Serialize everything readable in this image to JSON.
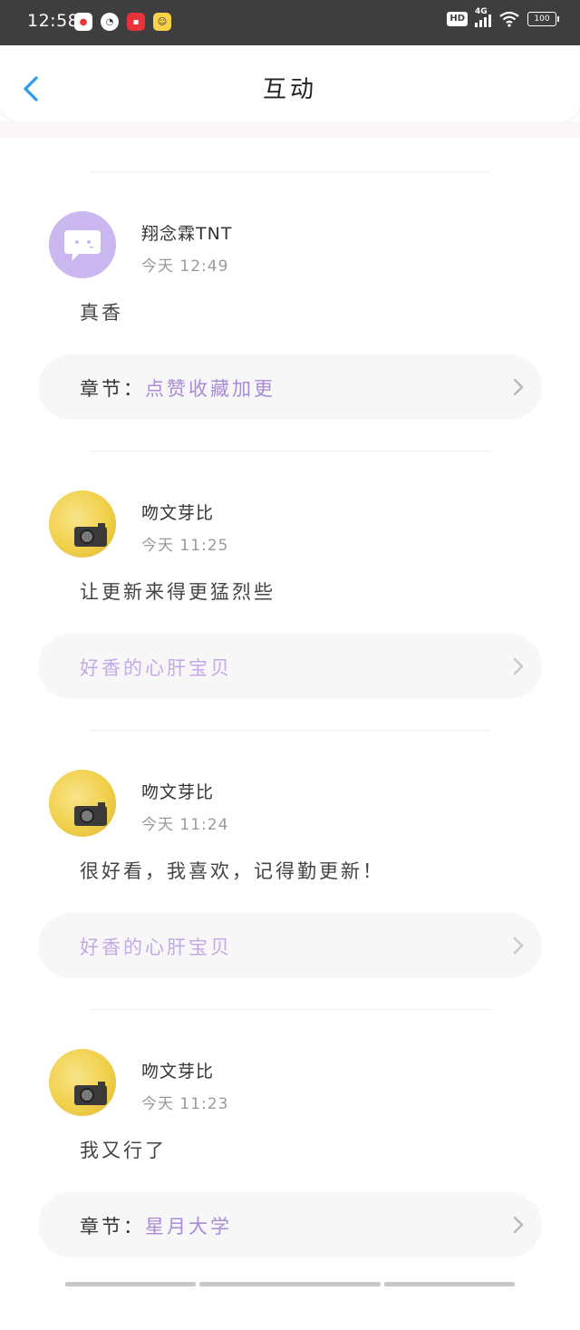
{
  "status_bar": {
    "time": "12:58",
    "network": "4G",
    "hd_label": "HD",
    "battery": "100"
  },
  "header": {
    "title": "互动"
  },
  "entries": [
    {
      "username": "翔念霖TNT",
      "time": "今天 12:49",
      "comment": "真香",
      "chapter_prefix": "章节：",
      "chapter_name": "点赞收藏加更"
    },
    {
      "username": "吻文芽比",
      "time": "今天 11:25",
      "comment": "让更新来得更猛烈些",
      "chapter_prefix": "",
      "chapter_name": "好香的心肝宝贝"
    },
    {
      "username": "吻文芽比",
      "time": "今天 11:24",
      "comment": "很好看，我喜欢，记得勤更新！",
      "chapter_prefix": "",
      "chapter_name": "好香的心肝宝贝"
    },
    {
      "username": "吻文芽比",
      "time": "今天 11:23",
      "comment": "我又行了",
      "chapter_prefix": "章节：",
      "chapter_name": "星月大学"
    }
  ],
  "colors": {
    "accent_blue": "#2b9bf0",
    "chapter_purple": "#a98bd6",
    "avatar_purple": "#cbb7f0"
  }
}
